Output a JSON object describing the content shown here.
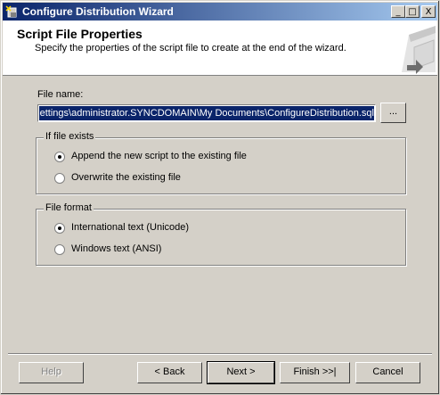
{
  "window": {
    "title": "Configure Distribution Wizard",
    "caption_buttons": {
      "minimize": "_",
      "maximize": "□",
      "close": "X"
    }
  },
  "header": {
    "title": "Script File Properties",
    "subtitle": "Specify the properties of the script file to create at the end of the wizard."
  },
  "file": {
    "label": "File name:",
    "value": "Settings\\administrator.SYNCDOMAIN\\My Documents\\ConfigureDistribution.sql",
    "browse_label": "..."
  },
  "if_exists": {
    "label": "If file exists",
    "options": [
      {
        "label": "Append the new script to the existing file",
        "checked": true
      },
      {
        "label": "Overwrite the existing file",
        "checked": false
      }
    ]
  },
  "file_format": {
    "label": "File format",
    "options": [
      {
        "label": "International text (Unicode)",
        "checked": true
      },
      {
        "label": "Windows text (ANSI)",
        "checked": false
      }
    ]
  },
  "buttons": {
    "help": "Help",
    "back": "< Back",
    "next": "Next >",
    "finish": "Finish >>|",
    "cancel": "Cancel"
  }
}
